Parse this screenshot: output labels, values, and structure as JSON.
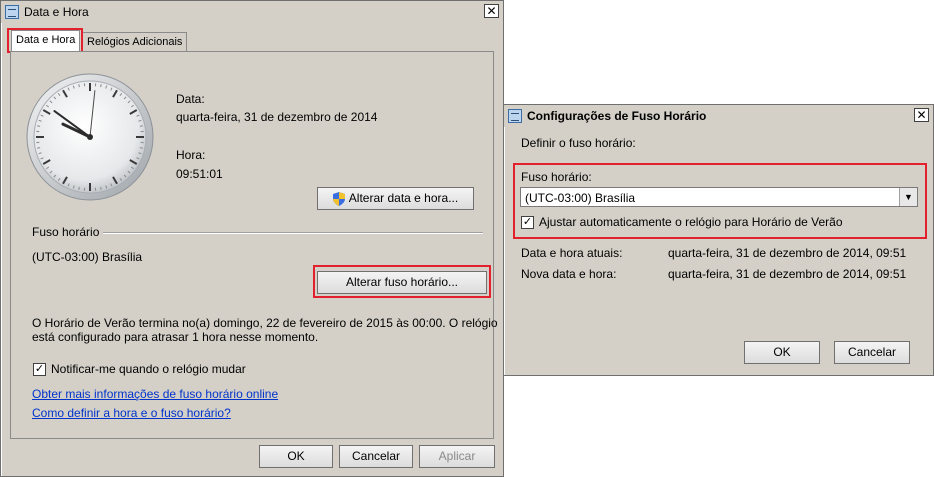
{
  "date_time_window": {
    "title": "Data e Hora",
    "tabs": [
      "Data e Hora",
      "Relógios Adicionais"
    ],
    "date_label": "Data:",
    "date_value": "quarta-feira, 31 de dezembro de 2014",
    "time_label": "Hora:",
    "time_value": "09:51:01",
    "change_datetime_button": "Alterar data e hora...",
    "timezone_section_label": "Fuso horário",
    "timezone_value": "(UTC-03:00) Brasília",
    "change_timezone_button": "Alterar fuso horário...",
    "dst_note_line1": "O Horário de Verão termina no(a) domingo, 22 de fevereiro de 2015 às 00:00. O relógio",
    "dst_note_line2": "está configurado para atrasar 1 hora nesse momento.",
    "notify_checkbox_label": "Notificar-me quando o relógio mudar",
    "notify_checked": true,
    "link_more_info": "Obter mais informações de fuso horário online",
    "link_how_to": "Como definir a hora e o fuso horário?",
    "ok_button": "OK",
    "cancel_button": "Cancelar",
    "apply_button": "Aplicar",
    "clock_time": {
      "hours": 9,
      "minutes": 51,
      "seconds": 1
    }
  },
  "timezone_window": {
    "title": "Configurações de Fuso Horário",
    "set_timezone_label": "Definir o fuso horário:",
    "timezone_label": "Fuso horário:",
    "timezone_selected": "(UTC-03:00) Brasília",
    "dst_checkbox_label": "Ajustar automaticamente o relógio para Horário de Verão",
    "dst_checked": true,
    "current_label": "Data e hora atuais:",
    "current_value": "quarta-feira, 31 de dezembro de 2014, 09:51",
    "new_label": "Nova data e hora:",
    "new_value": "quarta-feira, 31 de dezembro de 2014, 09:51",
    "ok_button": "OK",
    "cancel_button": "Cancelar"
  },
  "highlight_color": "#e3212d"
}
